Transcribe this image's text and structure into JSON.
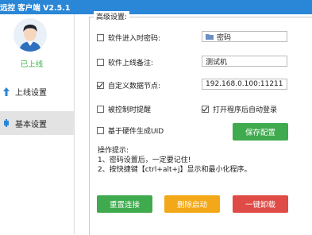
{
  "window": {
    "title": "远控  客户端 V2.5.1"
  },
  "sidebar": {
    "status": "已上线",
    "items": [
      {
        "label": "上线设置",
        "icon": "upload-arrow-icon"
      },
      {
        "label": "基本设置",
        "icon": "settings-icon"
      }
    ]
  },
  "settings": {
    "group_title": "高级设置:",
    "password_label": "软件进入时密码:",
    "password_value": "密码",
    "remark_label": "软件上线备注:",
    "remark_value": "测试机",
    "node_label": "自定义数据节点:",
    "node_value": "192.168.0.100:11211",
    "remind_label": "被控制时提醒",
    "autologin_label": "打开程序后自动登录",
    "uid_label": "基于硬件生成UID",
    "save_label": "保存配置"
  },
  "checkboxes": {
    "password": false,
    "remark": false,
    "node": true,
    "remind": false,
    "autologin": true,
    "uid": false
  },
  "tips": {
    "title": "操作提示:",
    "line1": "1、密码设置后，一定要记住!",
    "line2": "2、按快捷键【ctrl+alt+j】显示和最小化程序。"
  },
  "buttons": {
    "reset": "重置连接",
    "delete_autostart": "删除启动",
    "uninstall": "一键卸载"
  },
  "colors": {
    "titlebar": "#2a86d6",
    "online": "#3fb34f",
    "green_button": "#3faa4e",
    "orange_button": "#f2a818",
    "red_button": "#df4b46"
  }
}
